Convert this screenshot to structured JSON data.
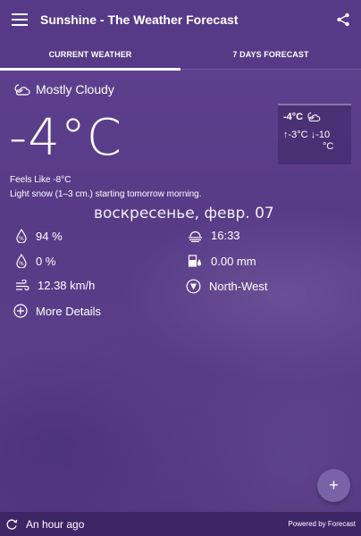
{
  "app": {
    "title": "Sunshine - The Weather Forecast"
  },
  "tabs": [
    {
      "label": "CURRENT WEATHER",
      "active": true
    },
    {
      "label": "7 DAYS FORECAST",
      "active": false
    }
  ],
  "current": {
    "condition": "Mostly Cloudy",
    "condition_icon": "cloud-moon-icon",
    "temperature": "-4°C",
    "feels_like": "Feels Like -8°C",
    "forecast_text": "Light snow (1–3 cm.) starting tomorrow morning.",
    "date": "воскресенье, февр. 07"
  },
  "mini_card": {
    "temp": "-4°C",
    "high": "↑-3°C",
    "low": "↓-10",
    "low_unit": "°C"
  },
  "details": {
    "humidity": "94 %",
    "sunset": "16:33",
    "precip_probability": "0 %",
    "precip_amount": "0.00 mm",
    "wind_speed": "12.38 km/h",
    "wind_direction": "North-West",
    "more_label": "More Details"
  },
  "footer": {
    "updated": "An hour ago",
    "powered_by": "Powered by Forecast"
  },
  "fab": {
    "label": "+"
  },
  "colors": {
    "primary": "#563a87",
    "footer": "#3e2566",
    "fab": "#7a62a8"
  }
}
